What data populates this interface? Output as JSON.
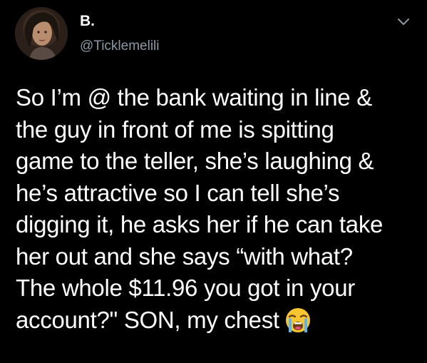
{
  "tweet": {
    "display_name": "B.",
    "handle": "@Ticklemelili",
    "text_lines": [
      "So I’m @ the bank waiting in line &",
      "the guy in front of me is spitting",
      "game to the teller, she’s laughing &",
      "he’s attractive so I can tell she’s",
      "digging it, he asks her if he can take",
      "her out and she says “with what?",
      "The whole $11.96 you got in your",
      "account?\" SON, my chest"
    ],
    "emoji": "loudly-crying-face"
  },
  "colors": {
    "background": "#000000",
    "text": "#ffffff",
    "handle": "#8b98a5"
  },
  "icons": {
    "menu": "chevron-down-icon"
  }
}
